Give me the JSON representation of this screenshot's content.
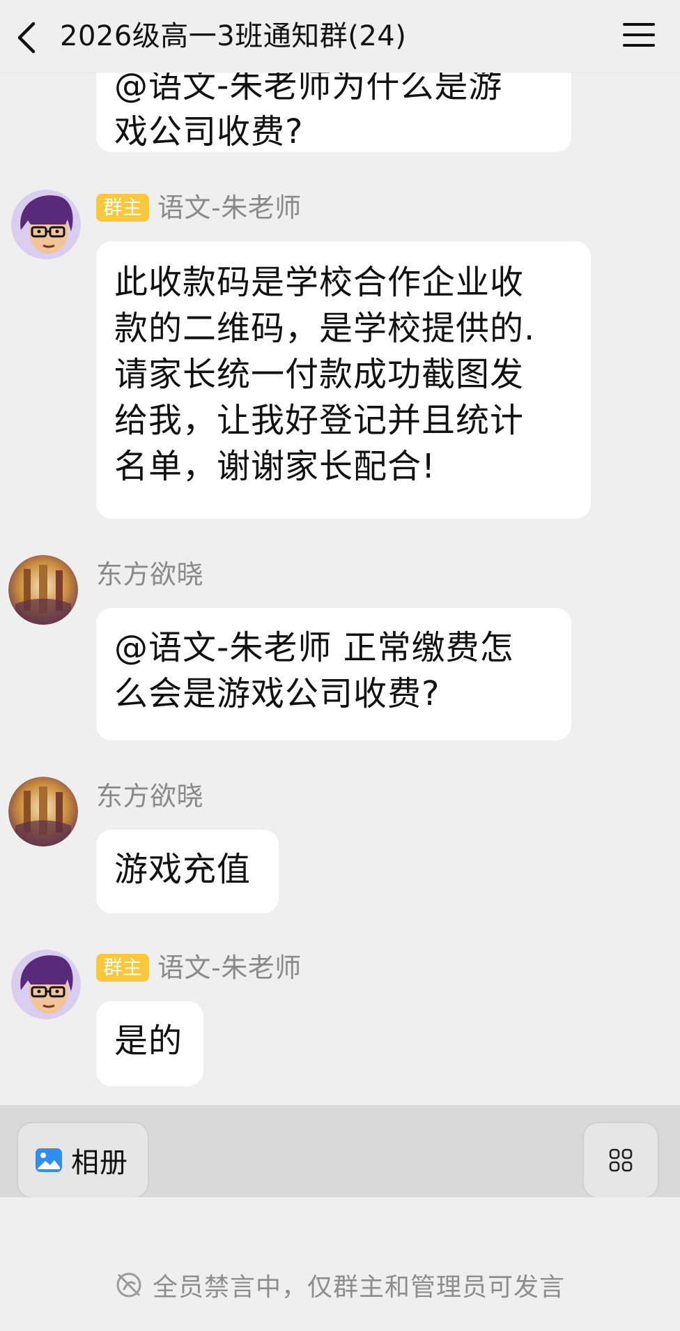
{
  "header": {
    "title": "2026级高一3班通知群(24)",
    "back_icon": "chevron-left-icon",
    "menu_icon": "hamburger-menu-icon"
  },
  "messages": [
    {
      "sender": "",
      "badge": "",
      "text_line1": "@语文-朱老师为什么是游",
      "text_line2": "戏公司收费?"
    },
    {
      "sender": "语文-朱老师",
      "badge": "群主",
      "lines": [
        "此收款码是学校合作企业收",
        "款的二维码，是学校提供的.",
        "请家长统一付款成功截图发",
        "给我，让我好登记并且统计",
        "名单，谢谢家长配合!"
      ]
    },
    {
      "sender": "东方欲晓",
      "lines": [
        "@语文-朱老师 正常缴费怎",
        "么会是游戏公司收费?"
      ]
    },
    {
      "sender": "东方欲晓",
      "lines": [
        "游戏充值"
      ]
    },
    {
      "sender": "语文-朱老师",
      "badge": "群主",
      "lines": [
        "是的"
      ]
    }
  ],
  "toolbar": {
    "album_label": "相册",
    "album_icon": "photo-album-icon",
    "apps_icon": "apps-grid-icon"
  },
  "footer": {
    "muted_text": "全员禁言中，仅群主和管理员可发言",
    "muted_icon": "mute-icon"
  },
  "colors": {
    "background": "#efefef",
    "bubble": "#ffffff",
    "owner_badge": "#f8c73a",
    "name_gray": "#8a8a8a",
    "toolbar": "#d9d9d9",
    "album_icon_blue": "#2f8ff0"
  }
}
